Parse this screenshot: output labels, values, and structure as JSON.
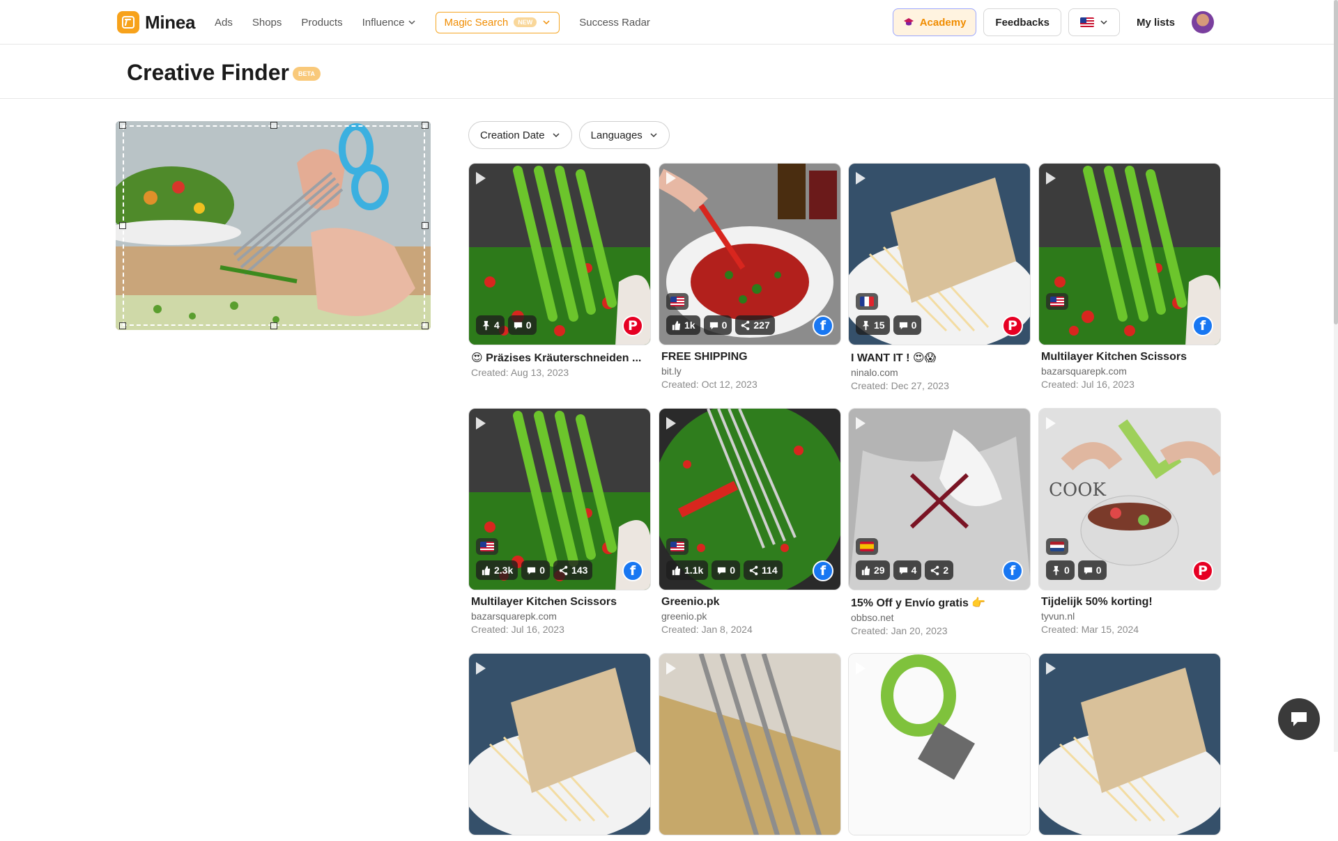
{
  "nav": {
    "logo": "Minea",
    "links": [
      "Ads",
      "Shops",
      "Products"
    ],
    "influence": "Influence",
    "magic_search": "Magic Search",
    "new_badge": "NEW",
    "success_radar": "Success Radar",
    "academy": "Academy",
    "feedbacks": "Feedbacks",
    "my_lists": "My lists"
  },
  "page": {
    "title": "Creative Finder",
    "beta_badge": "BETA"
  },
  "filters": {
    "creation_date": "Creation Date",
    "languages": "Languages"
  },
  "cards": [
    {
      "title": "😍 Präzises Kräuterschneiden ...",
      "domain": "",
      "created": "Created: Aug 13, 2023",
      "flag": "",
      "network": "pinterest",
      "stats": [
        {
          "icon": "pin-icon",
          "value": "4"
        },
        {
          "icon": "comment-icon",
          "value": "0"
        }
      ],
      "thumb": "greens"
    },
    {
      "title": "FREE SHIPPING",
      "domain": "bit.ly",
      "created": "Created: Oct 12, 2023",
      "flag": "us",
      "network": "facebook",
      "stats": [
        {
          "icon": "like-icon",
          "value": "1k"
        },
        {
          "icon": "comment-icon",
          "value": "0"
        },
        {
          "icon": "share-icon",
          "value": "227"
        }
      ],
      "thumb": "plate"
    },
    {
      "title": "I WANT IT ! 😍😱",
      "domain": "ninalo.com",
      "created": "Created: Dec 27, 2023",
      "flag": "fr",
      "network": "pinterest",
      "stats": [
        {
          "icon": "pin-icon",
          "value": "15"
        },
        {
          "icon": "comment-icon",
          "value": "0"
        }
      ],
      "thumb": "pasta"
    },
    {
      "title": "Multilayer Kitchen Scissors",
      "domain": "bazarsquarepk.com",
      "created": "Created: Jul 16, 2023",
      "flag": "us",
      "network": "facebook",
      "stats": [],
      "thumb": "greens"
    },
    {
      "title": "Multilayer Kitchen Scissors",
      "domain": "bazarsquarepk.com",
      "created": "Created: Jul 16, 2023",
      "flag": "us",
      "network": "facebook",
      "stats": [
        {
          "icon": "like-icon",
          "value": "2.3k"
        },
        {
          "icon": "comment-icon",
          "value": "0"
        },
        {
          "icon": "share-icon",
          "value": "143"
        }
      ],
      "thumb": "greens"
    },
    {
      "title": "Greenio.pk",
      "domain": "greenio.pk",
      "created": "Created: Jan 8, 2024",
      "flag": "us",
      "network": "facebook",
      "stats": [
        {
          "icon": "like-icon",
          "value": "1.1k"
        },
        {
          "icon": "comment-icon",
          "value": "0"
        },
        {
          "icon": "share-icon",
          "value": "114"
        }
      ],
      "thumb": "pan"
    },
    {
      "title": "15% Off y Envío gratis 👉",
      "domain": "obbso.net",
      "created": "Created: Jan 20, 2023",
      "flag": "es",
      "network": "facebook",
      "stats": [
        {
          "icon": "like-icon",
          "value": "29"
        },
        {
          "icon": "comment-icon",
          "value": "4"
        },
        {
          "icon": "share-icon",
          "value": "2"
        }
      ],
      "thumb": "gray"
    },
    {
      "title": "Tijdelijk 50% korting!",
      "domain": "tyvun.nl",
      "created": "Created: Mar 15, 2024",
      "flag": "nl",
      "network": "pinterest",
      "stats": [
        {
          "icon": "pin-icon",
          "value": "0"
        },
        {
          "icon": "comment-icon",
          "value": "0"
        }
      ],
      "thumb": "bowl"
    },
    {
      "title": "",
      "domain": "",
      "created": "",
      "flag": "",
      "network": "",
      "stats": [],
      "thumb": "pasta"
    },
    {
      "title": "",
      "domain": "",
      "created": "",
      "flag": "",
      "network": "",
      "stats": [],
      "thumb": "scissors"
    },
    {
      "title": "",
      "domain": "",
      "created": "",
      "flag": "",
      "network": "",
      "stats": [],
      "thumb": "green-scissors"
    },
    {
      "title": "",
      "domain": "",
      "created": "",
      "flag": "",
      "network": "",
      "stats": [],
      "thumb": "pasta"
    }
  ]
}
